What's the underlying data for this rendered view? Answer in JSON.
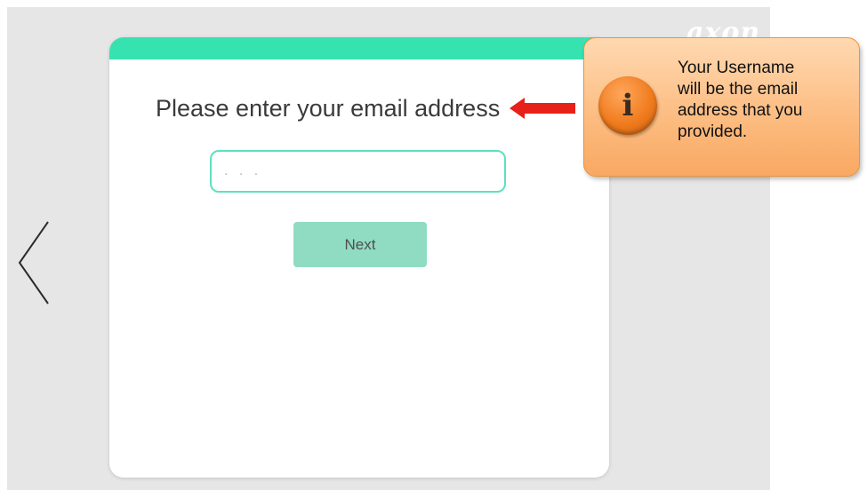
{
  "top_strip": {
    "text": ""
  },
  "logo": {
    "text": "axon"
  },
  "card": {
    "prompt": "Please enter your email address",
    "email_field": {
      "value": "",
      "placeholder": ". . ."
    },
    "next_label": "Next"
  },
  "callout": {
    "lines": [
      "Your Username",
      "will be the email",
      "address that you",
      "provided."
    ]
  },
  "colors": {
    "accent_bar": "#36e2b0",
    "field_border": "#5fe0bd",
    "next_button": "#8fdcc3",
    "callout_orange": "#f9a862",
    "arrow_red": "#e8201a"
  },
  "icons": {
    "back": "chevron-left-icon",
    "info": "info-icon",
    "arrow": "arrow-left-icon"
  }
}
